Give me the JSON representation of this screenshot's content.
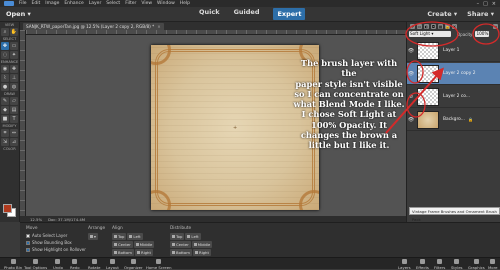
{
  "menubar": {
    "items": [
      "File",
      "Edit",
      "Image",
      "Enhance",
      "Layer",
      "Select",
      "Filter",
      "View",
      "Window",
      "Help"
    ],
    "window_controls": [
      "–",
      "□",
      "×"
    ]
  },
  "modebar": {
    "open_label": "Open",
    "modes": [
      "Quick",
      "Guided",
      "Expert"
    ],
    "active_mode": "Expert",
    "create_label": "Create",
    "share_label": "Share"
  },
  "document_tab": {
    "title": "SANJK_RTW_paperTan.jpg @ 12.5% (Layer 2 copy 2, RGB/8) *",
    "close": "×"
  },
  "toolbox": {
    "sections": [
      "VIEW",
      "SELECT",
      "ENHANCE",
      "DRAW",
      "MODIFY",
      "COLOR"
    ],
    "foreground_color": "#b03a1e",
    "background_color": "#ffffff"
  },
  "annotation": {
    "text": "The brush layer with the\npaper style isn't visible\nso I can concentrate on\nwhat Blend Mode I like.\nI chose Soft Light at\n100% Opacity. It\nchanges the brown a\nlittle but I like it."
  },
  "statusbar": {
    "zoom": "12.5%",
    "doc_info": "Doc: 37.1M/174.4M"
  },
  "layers_panel": {
    "blend_mode": "Soft Light",
    "opacity_label": "Opacity:",
    "opacity_value": "100%",
    "layers": [
      {
        "name": "Layer 1",
        "selected": false,
        "visible": true,
        "thumb": "transparent"
      },
      {
        "name": "Layer 2 copy 2",
        "selected": true,
        "visible": true,
        "thumb": "transparent"
      },
      {
        "name": "Layer 2 co...",
        "selected": false,
        "visible": false,
        "thumb": "transparent"
      },
      {
        "name": "Backgro...",
        "selected": false,
        "visible": true,
        "thumb": "paper"
      }
    ],
    "tooltip": "Vintage Frame Brushes and Ornament Brush Pack"
  },
  "tool_options": {
    "move_label": "Move",
    "auto_select": "Auto Select Layer",
    "show_bounding": "Show Bounding Box",
    "show_highlight": "Show Highlight on Rollover",
    "arrange_label": "Arrange",
    "align_label": "Align",
    "align_buttons": [
      "Top",
      "Left",
      "Center",
      "Middle",
      "Bottom",
      "Right"
    ],
    "distribute_label": "Distribute",
    "distribute_buttons": [
      "Top",
      "Left",
      "Center",
      "Middle",
      "Bottom",
      "Right"
    ]
  },
  "taskbar": {
    "left": [
      "Photo Bin",
      "Tool Options",
      "Undo",
      "Redo",
      "Rotate",
      "Layout",
      "Organizer",
      "Home Screen"
    ],
    "right": [
      "Layers",
      "Effects",
      "Filters",
      "Styles",
      "Graphics",
      "More"
    ]
  },
  "colors": {
    "accent": "#2d6ea8",
    "annotation_circles": "#d42a2a",
    "selected_layer": "#5b83b3"
  }
}
